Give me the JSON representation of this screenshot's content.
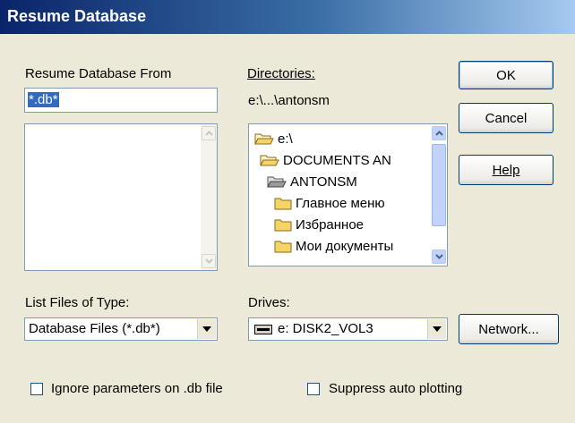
{
  "window": {
    "title": "Resume Database"
  },
  "resume_from": {
    "label": "Resume Database From",
    "value": "*.db*"
  },
  "directories": {
    "label": "Directories:",
    "path": "e:\\...\\antonsm",
    "items": [
      {
        "label": "e:\\",
        "icon": "folder-open-icon"
      },
      {
        "label": "DOCUMENTS AN",
        "icon": "folder-open-icon"
      },
      {
        "label": "ANTONSM",
        "icon": "folder-open-icon"
      },
      {
        "label": "Главное меню",
        "icon": "folder-icon"
      },
      {
        "label": "Избранное",
        "icon": "folder-icon"
      },
      {
        "label": "Мои документы",
        "icon": "folder-icon"
      }
    ]
  },
  "buttons": {
    "ok": "OK",
    "cancel": "Cancel",
    "help": "Help",
    "network": "Network..."
  },
  "file_type": {
    "label": "List Files of Type:",
    "value": "Database Files (*.db*)"
  },
  "drives": {
    "label": "Drives:",
    "value": "e: DISK2_VOL3",
    "icon": "drive-icon"
  },
  "options": {
    "ignore_params": {
      "label": "Ignore parameters on .db file",
      "checked": false
    },
    "suppress_plot": {
      "label": "Suppress auto plotting",
      "checked": false
    }
  }
}
